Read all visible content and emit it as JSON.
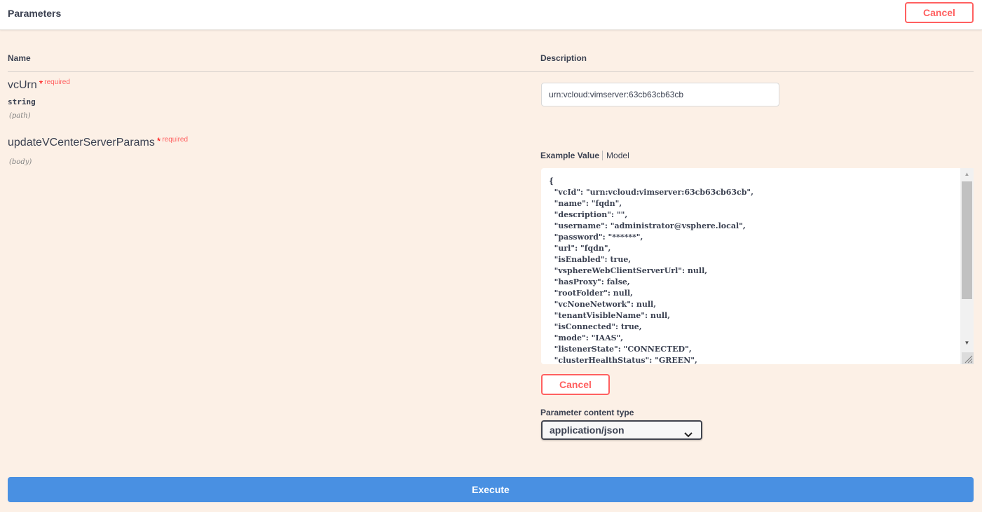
{
  "header": {
    "title": "Parameters",
    "cancel_label": "Cancel"
  },
  "table": {
    "col_name": "Name",
    "col_description": "Description"
  },
  "params": [
    {
      "name": "vcUrn",
      "required_star": "*",
      "required_label": "required",
      "type": "string",
      "in": "(path)",
      "value": "urn:vcloud:vimserver:63cb63cb63cb"
    },
    {
      "name": "updateVCenterServerParams",
      "required_star": "*",
      "required_label": "required",
      "in": "(body)"
    }
  ],
  "body_editor": {
    "tab_example": "Example Value",
    "tab_model": "Model",
    "example_value": "{\n  \"vcId\": \"urn:vcloud:vimserver:63cb63cb63cb\",\n  \"name\": \"fqdn\",\n  \"description\": \"\",\n  \"username\": \"administrator@vsphere.local\",\n  \"password\": \"******\",\n  \"url\": \"fqdn\",\n  \"isEnabled\": true,\n  \"vsphereWebClientServerUrl\": null,\n  \"hasProxy\": false,\n  \"rootFolder\": null,\n  \"vcNoneNetwork\": null,\n  \"tenantVisibleName\": null,\n  \"isConnected\": true,\n  \"mode\": \"IAAS\",\n  \"listenerState\": \"CONNECTED\",\n  \"clusterHealthStatus\": \"GREEN\",",
    "cancel_label": "Cancel"
  },
  "content_type": {
    "label": "Parameter content type",
    "selected": "application/json"
  },
  "execute_label": "Execute",
  "icons": {
    "dropdown": "chevron-down-icon",
    "scroll_up": "scroll-up-arrow-icon",
    "scroll_down": "scroll-down-arrow-icon",
    "resize": "resize-grip-icon"
  },
  "colors": {
    "background": "#fcf0e6",
    "cancel": "#ff6060",
    "execute": "#4990e2",
    "required": "#ff0000"
  }
}
